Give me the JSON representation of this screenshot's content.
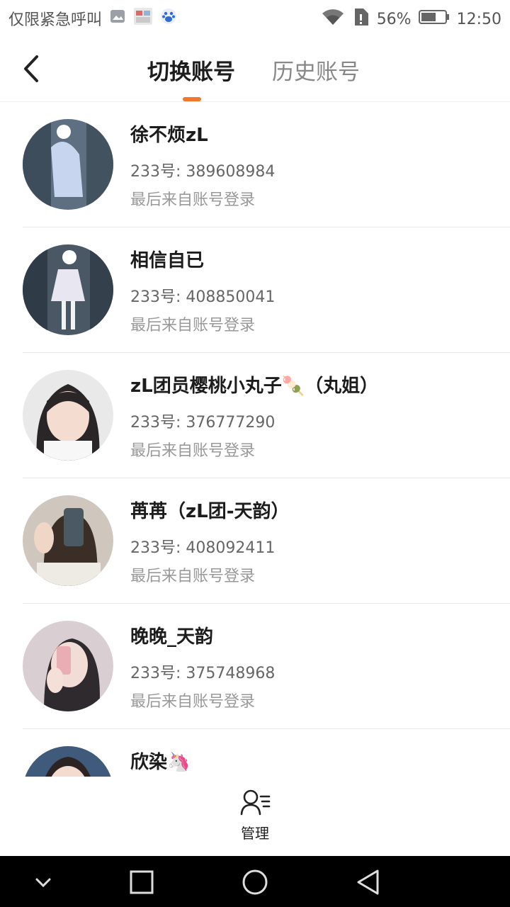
{
  "status_bar": {
    "carrier": "仅限紧急呼叫",
    "battery": "56%",
    "time": "12:50"
  },
  "header": {
    "tab_active": "切换账号",
    "tab_inactive": "历史账号"
  },
  "accounts": [
    {
      "name": "徐不烦zL",
      "id_prefix": "233号: ",
      "id": "389608984",
      "sub": "最后来自账号登录"
    },
    {
      "name": "相信自已",
      "id_prefix": "233号: ",
      "id": "408850041",
      "sub": "最后来自账号登录"
    },
    {
      "name": "zL团员樱桃小丸子🍡（丸姐）",
      "id_prefix": "233号: ",
      "id": "376777290",
      "sub": "最后来自账号登录"
    },
    {
      "name": "苒苒（zL团-天韵）",
      "id_prefix": "233号: ",
      "id": "408092411",
      "sub": "最后来自账号登录"
    },
    {
      "name": "晚晚_天韵",
      "id_prefix": "233号: ",
      "id": "375748968",
      "sub": "最后来自账号登录"
    },
    {
      "name": "欣染🦄",
      "id_prefix": "",
      "id": "",
      "sub": ""
    }
  ],
  "bottom": {
    "manage_label": "管理",
    "manage_icon": "person-list-icon"
  },
  "colors": {
    "accent": "#f0772c"
  }
}
